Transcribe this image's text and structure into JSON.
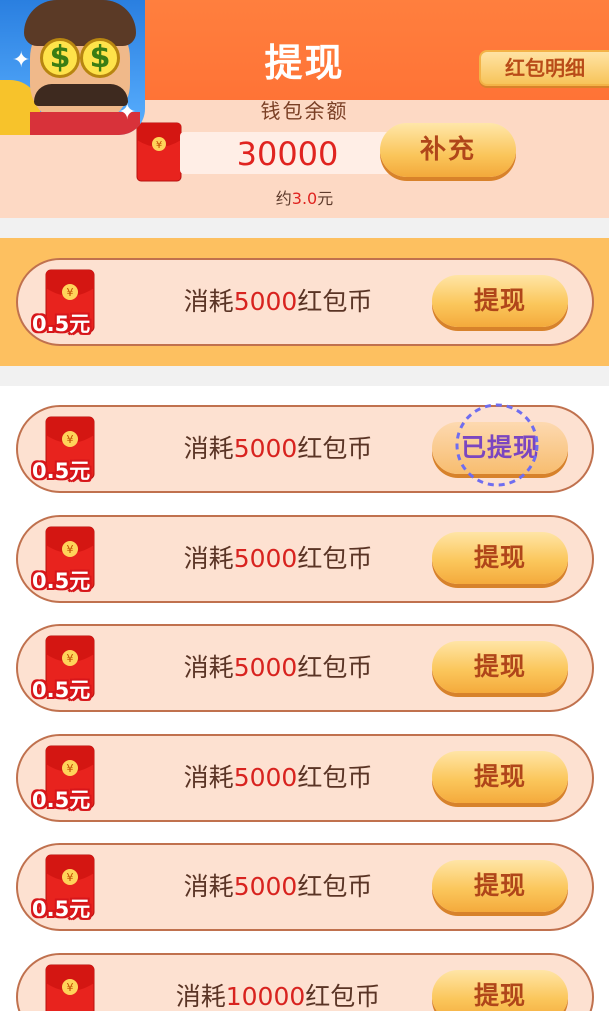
{
  "header": {
    "title": "提现",
    "detail_label": "红包明细"
  },
  "balance": {
    "label": "钱包余额",
    "amount": "30000",
    "refill_label": "补充",
    "approx_prefix": "约",
    "approx_value": "3.0",
    "approx_suffix": "元"
  },
  "rows": [
    {
      "badge": "0.5元",
      "cost_prefix": "消耗",
      "cost_num": "5000",
      "cost_suffix": "红包币",
      "button": "提现",
      "state": "featured"
    },
    {
      "badge": "0.5元",
      "cost_prefix": "消耗",
      "cost_num": "5000",
      "cost_suffix": "红包币",
      "button": "已提现",
      "state": "done"
    },
    {
      "badge": "0.5元",
      "cost_prefix": "消耗",
      "cost_num": "5000",
      "cost_suffix": "红包币",
      "button": "提现",
      "state": "normal"
    },
    {
      "badge": "0.5元",
      "cost_prefix": "消耗",
      "cost_num": "5000",
      "cost_suffix": "红包币",
      "button": "提现",
      "state": "normal"
    },
    {
      "badge": "0.5元",
      "cost_prefix": "消耗",
      "cost_num": "5000",
      "cost_suffix": "红包币",
      "button": "提现",
      "state": "normal"
    },
    {
      "badge": "0.5元",
      "cost_prefix": "消耗",
      "cost_num": "5000",
      "cost_suffix": "红包币",
      "button": "提现",
      "state": "normal"
    },
    {
      "badge": "",
      "cost_prefix": "消耗",
      "cost_num": "10000",
      "cost_suffix": "红包币",
      "button": "提现",
      "state": "normal"
    }
  ],
  "icons": {
    "app": "money-eyes-mascot-icon",
    "envelope": "red-envelope-icon",
    "stamp": "withdrawn-stamp-icon"
  },
  "colors": {
    "header_bg": "#ff7a3a",
    "balance_bg": "#fdd9c4",
    "featured_bg": "#fdc060",
    "amount_red": "#e02420",
    "button_gold": "#fbc75c"
  }
}
